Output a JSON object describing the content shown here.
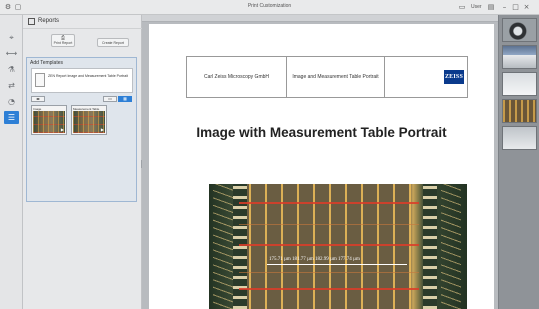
{
  "window": {
    "title": "Print Customization",
    "toolbar_right_text": "User"
  },
  "panel": {
    "title": "Reports",
    "print_report_label": "Print Report",
    "create_report_label": "Create Report",
    "templates_label": "Add Templates",
    "report_item_text": "ZEN Report Image and Measurement Table Portrait",
    "thumbnails": [
      {
        "label": "Image"
      },
      {
        "label": "Measurement Table"
      }
    ]
  },
  "document": {
    "header_company": "Carl Zeiss Microscopy GmbH",
    "header_template": "Image and Measurement Table Portrait",
    "logo_text": "ZEISS",
    "page_title": "Image with Measurement Table Portrait",
    "measurement_text": "175.71 µm  181.77 µm  182.99 µm  177.74 µm"
  },
  "colors": {
    "accent": "#2d7fd6",
    "zeiss_blue": "#0a3a8c"
  }
}
